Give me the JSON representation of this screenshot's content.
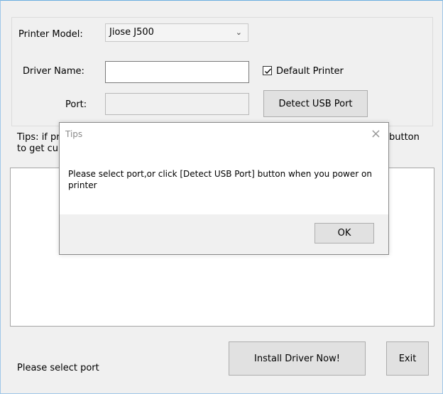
{
  "form": {
    "printer_model_label": "Printer Model:",
    "printer_model_value": "Jiose J500",
    "driver_name_label": "Driver Name:",
    "driver_name_value": "",
    "default_printer_label": "Default Printer",
    "default_printer_checked": true,
    "port_label": "Port:",
    "port_value": "",
    "detect_usb_label": "Detect USB Port"
  },
  "tips": {
    "line1_visible": "Tips: if pr",
    "line2_visible": "to get cu",
    "right_visible": "button"
  },
  "buttons": {
    "install_label": "Install Driver Now!",
    "exit_label": "Exit"
  },
  "status_text": "Please select port",
  "dialog": {
    "title": "Tips",
    "close_glyph": "×",
    "message_line1": "Please select port,or click [Detect USB Port] button when you power on",
    "message_line2": "printer",
    "ok_label": "OK"
  }
}
